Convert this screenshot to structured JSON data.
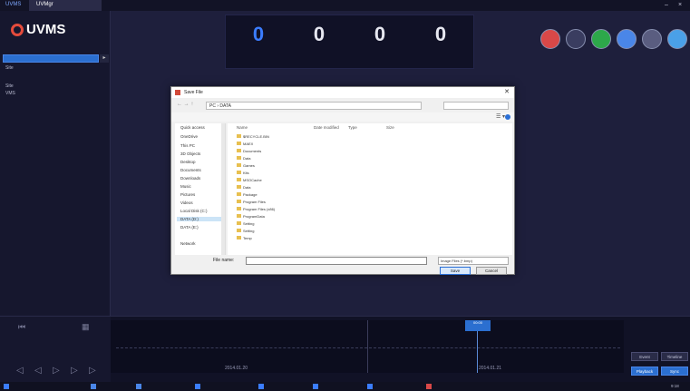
{
  "window": {
    "tabs": [
      "UVMS",
      "UVMgr"
    ],
    "controls": [
      "–",
      "×"
    ]
  },
  "sidebar": {
    "logo_text": "UVMS",
    "tree": [
      "Site",
      "Site",
      "VMS"
    ]
  },
  "counters": [
    {
      "value": "0",
      "accent": true
    },
    {
      "value": "0",
      "accent": false
    },
    {
      "value": "0",
      "accent": false
    },
    {
      "value": "0",
      "accent": false
    }
  ],
  "toolbar": {
    "tools": [
      {
        "icon": "map-pin-icon",
        "color": "#d94848"
      },
      {
        "icon": "cctv-icon",
        "color": "#e8e8f0"
      },
      {
        "icon": "alarm-icon",
        "color": "#2da84a"
      },
      {
        "icon": "record-icon",
        "color": "#4a86e8"
      },
      {
        "icon": "edit-icon",
        "color": "#d0d0d8"
      },
      {
        "icon": "search-icon",
        "color": "#4aa0e8"
      }
    ]
  },
  "dialog": {
    "title": "Save File",
    "address_segments": [
      "PC",
      "DATA"
    ],
    "nav_items": [
      "Quick access",
      "OneDrive",
      "This PC",
      "3D Objects",
      "Desktop",
      "Documents",
      "Downloads",
      "Music",
      "Pictures",
      "Videos",
      "Local Disk (C:)",
      "DATA (D:)",
      "DATA (E:)",
      "Network"
    ],
    "column_headers": [
      "Name",
      "Date modified",
      "Type",
      "Size"
    ],
    "files": [
      {
        "name": "$RECYCLE.BIN"
      },
      {
        "name": "MAEX"
      },
      {
        "name": "Documents"
      },
      {
        "name": "Data"
      },
      {
        "name": "Games"
      },
      {
        "name": "Kits"
      },
      {
        "name": "MSOCache"
      },
      {
        "name": "Data"
      },
      {
        "name": "Package"
      },
      {
        "name": "Program Files"
      },
      {
        "name": "Program Files (x86)"
      },
      {
        "name": "ProgramData"
      },
      {
        "name": "Setting"
      },
      {
        "name": "Setting"
      },
      {
        "name": "Temp"
      }
    ],
    "filename_label": "File name:",
    "filename_value": "",
    "file_type": "Image Files (*.bmp)",
    "buttons": {
      "save": "Save",
      "cancel": "Cancel"
    }
  },
  "timeline": {
    "dates": [
      "2014.01.20",
      "2014.01.21"
    ],
    "marker_label": "00:00",
    "right_buttons": [
      "Event",
      "Timeline",
      "Playback",
      "Sync"
    ]
  },
  "taskbar": {
    "clock": "9:18"
  }
}
